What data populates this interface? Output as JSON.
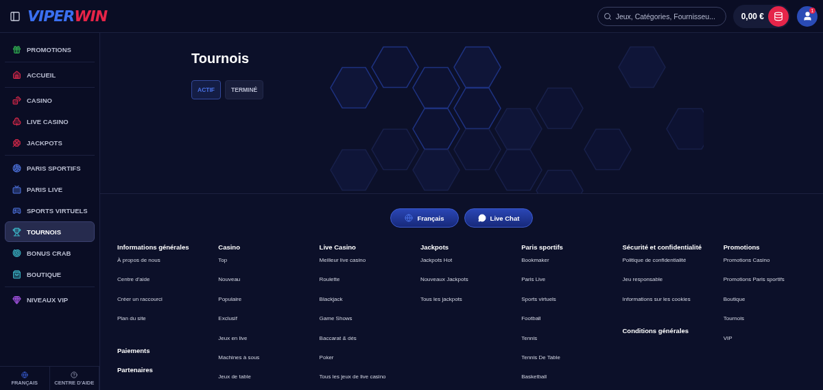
{
  "header": {
    "logo": {
      "part_1": "VIPER",
      "part_2": "WIN"
    },
    "search": {
      "placeholder": "Jeux, Catégories, Fournisseu..."
    },
    "balance": "0,00 €",
    "notification_badge": "1"
  },
  "sidebar": {
    "groups": [
      [
        {
          "label": "PROMOTIONS",
          "selected": false
        }
      ],
      [
        {
          "label": "ACCUEIL",
          "selected": false
        }
      ],
      [
        {
          "label": "CASINO",
          "selected": false
        },
        {
          "label": "LIVE CASINO",
          "selected": false
        },
        {
          "label": "JACKPOTS",
          "selected": false
        }
      ],
      [
        {
          "label": "PARIS SPORTIFS",
          "selected": false
        },
        {
          "label": "PARIS LIVE",
          "selected": false
        },
        {
          "label": "SPORTS VIRTUELS",
          "selected": false
        },
        {
          "label": "TOURNOIS",
          "selected": true
        },
        {
          "label": "BONUS CRAB",
          "selected": false
        },
        {
          "label": "BOUTIQUE",
          "selected": false
        }
      ],
      [
        {
          "label": "NIVEAUX VIP",
          "selected": false
        }
      ]
    ],
    "bottom": [
      {
        "kind": "language",
        "label": "FRANÇAIS"
      },
      {
        "kind": "help",
        "label": "CENTRE D'AIDE"
      }
    ]
  },
  "page": {
    "title": "Tournois",
    "tabs": [
      {
        "label": "ACTIF",
        "selected": true
      },
      {
        "label": "TERMINÉ",
        "selected": false
      }
    ]
  },
  "footer": {
    "buttons": [
      {
        "kind": "language",
        "label": "Français"
      },
      {
        "kind": "chat",
        "label": "Live Chat"
      }
    ],
    "columns": [
      [
        {
          "heading": "Informations générales",
          "links": [
            "À propos de nous",
            "Centre d'aide",
            "Créer un raccourci",
            "Plan du site"
          ]
        },
        {
          "heading": "Paiements"
        },
        {
          "heading": "Partenaires"
        }
      ],
      [
        {
          "heading": "Casino",
          "links": [
            "Top",
            "Nouveau",
            "Populaire",
            "Exclusif",
            "Jeux en live",
            "Machines à sous",
            "Jeux de table"
          ]
        }
      ],
      [
        {
          "heading": "Live Casino",
          "links": [
            "Meilleur live casino",
            "Roulette",
            "Blackjack",
            "Game Shows",
            "Baccarat & dés",
            "Poker",
            "Tous les jeux de live casino"
          ]
        }
      ],
      [
        {
          "heading": "Jackpots",
          "links": [
            "Jackpots Hot",
            "Nouveaux Jackpots",
            "Tous les jackpots"
          ]
        }
      ],
      [
        {
          "heading": "Paris sportifs",
          "links": [
            "Bookmaker",
            "Paris Live",
            "Sports virtuels",
            "Football",
            "Tennis",
            "Tennis De Table",
            "Basketball"
          ]
        }
      ],
      [
        {
          "heading": "Sécurité et confidentialité",
          "links": [
            "Politique de confidentialité",
            "Jeu responsable",
            "Informations sur les cookies"
          ]
        },
        {
          "heading": "Conditions générales"
        }
      ],
      [
        {
          "heading": "Promotions",
          "links": [
            "Promotions Casino",
            "Promotions Paris sportifs",
            "Boutique",
            "Tournois",
            "VIP"
          ]
        }
      ]
    ]
  }
}
